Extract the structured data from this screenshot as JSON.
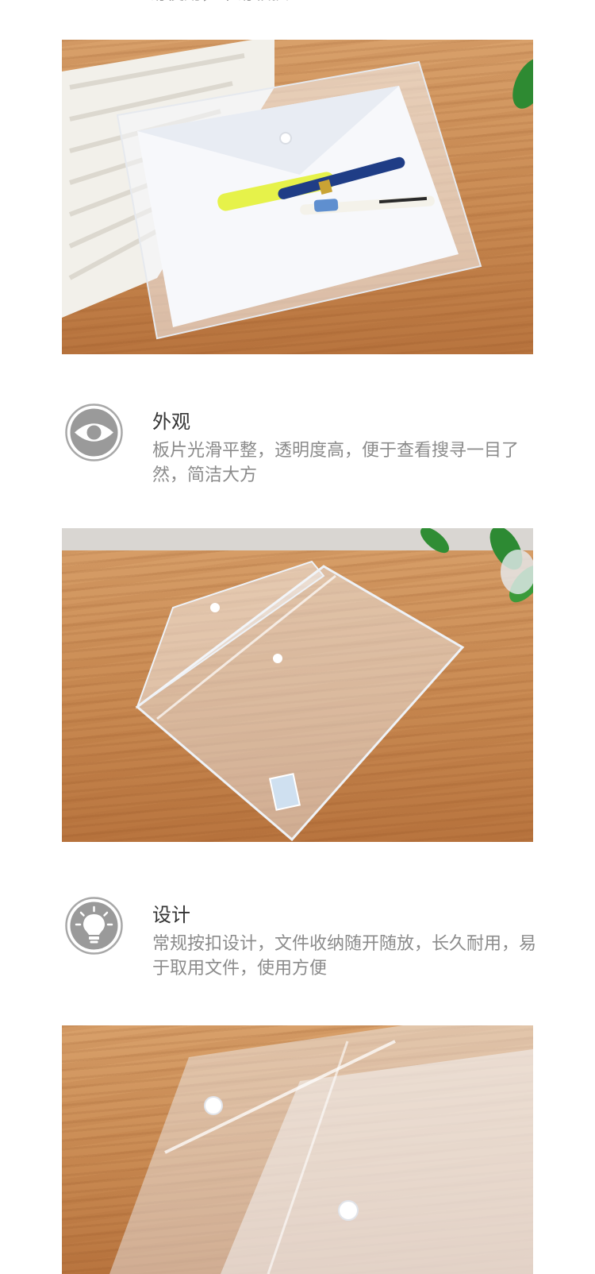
{
  "top_partial_text": "易使用，平易较换",
  "features": [
    {
      "icon": "eye-icon",
      "title": "外观",
      "description": "板片光滑平整，透明度高，便于查看搜寻一目了然，简洁大方"
    },
    {
      "icon": "lightbulb-icon",
      "title": "设计",
      "description": "常规按扣设计，文件收纳随开随放，长久耐用，易于取用文件，使用方便"
    }
  ],
  "colors": {
    "text_gray": "#8b8b8b",
    "title_dark": "#333333",
    "icon_gray": "#9a9a9a",
    "wood": "#c98a52"
  }
}
